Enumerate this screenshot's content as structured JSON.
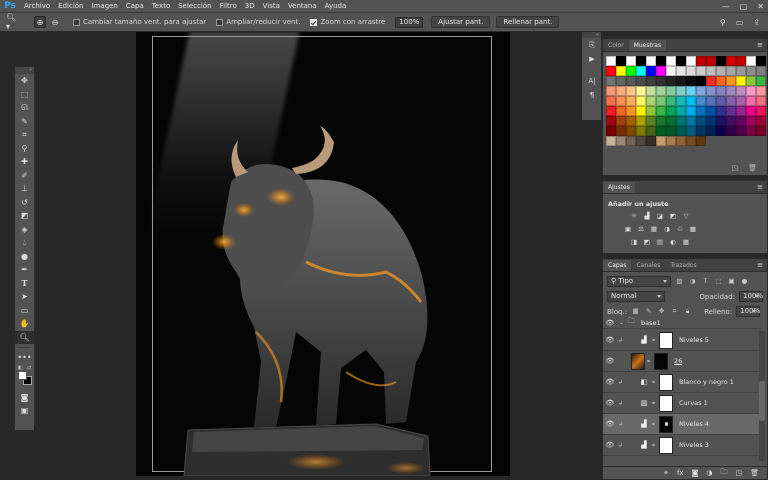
{
  "app": {
    "logo": "Ps"
  },
  "menubar": {
    "items": [
      "Archivo",
      "Edición",
      "Imagen",
      "Capa",
      "Texto",
      "Selección",
      "Filtro",
      "3D",
      "Vista",
      "Ventana",
      "Ayuda"
    ]
  },
  "options": {
    "resize_label": "Cambiar tamaño vent. para ajustar",
    "scrubby_label": "Ampliar/reducir vent.",
    "drag_label": "Zoom con arrastre",
    "zoom_value": "100%",
    "fit_label": "Ajustar pant.",
    "fill_label": "Rellenar pant."
  },
  "swatches": {
    "tabs": [
      "Color",
      "Muestras"
    ],
    "colors": [
      [
        "#ffffff",
        "#000000",
        "#ffffff",
        "#000000",
        "#ffffff",
        "#000000",
        "#ffffff",
        "#000000",
        "#ffffff",
        "#c00000",
        "#c00000",
        "#000000",
        "#d40000",
        "#c00000",
        "#ffffff",
        "#000000"
      ],
      [
        "#ff0000",
        "#ffff00",
        "#00ff00",
        "#00ffff",
        "#0000ff",
        "#ff00ff",
        "#ffffff",
        "#e6e6e6",
        "#d9d9d9",
        "#cccccc",
        "#bfbfbf",
        "#b3b3b3",
        "#a6a6a6",
        "#999999",
        "#8c8c8c",
        "#808080"
      ],
      [
        "#737373",
        "#666666",
        "#595959",
        "#4d4d4d",
        "#404040",
        "#333333",
        "#262626",
        "#1a1a1a",
        "#0d0d0d",
        "#000000",
        "#ee2e24",
        "#f26522",
        "#f7941d",
        "#fff200",
        "#8dc63f",
        "#39b54a"
      ],
      [
        "#f7977a",
        "#f9ad81",
        "#fdc68a",
        "#fff79a",
        "#c4df9b",
        "#a3d39c",
        "#82ca9d",
        "#7bcdc8",
        "#6ecff6",
        "#7ea7d8",
        "#8493ca",
        "#8882be",
        "#a187be",
        "#bc8dbf",
        "#f49ac2",
        "#f6989d"
      ],
      [
        "#f26c4f",
        "#f68e56",
        "#fbaf5d",
        "#fff568",
        "#acd373",
        "#7cc576",
        "#3bb878",
        "#1abbb4",
        "#00bff3",
        "#448ccb",
        "#5674b9",
        "#605ca8",
        "#855fa8",
        "#a863a8",
        "#f06eaa",
        "#f26d7d"
      ],
      [
        "#ed1c24",
        "#f26522",
        "#f7941d",
        "#fff200",
        "#8dc63f",
        "#39b54a",
        "#00a651",
        "#00a99d",
        "#00aeef",
        "#0072bc",
        "#0054a6",
        "#2e3192",
        "#662d91",
        "#92278f",
        "#ec008c",
        "#ed145b"
      ],
      [
        "#9e0b0f",
        "#a0410d",
        "#a36209",
        "#aba000",
        "#598527",
        "#1a7b30",
        "#007236",
        "#00746b",
        "#0076a3",
        "#004b80",
        "#003471",
        "#1b1464",
        "#440e62",
        "#630460",
        "#9e005d",
        "#9e0039"
      ],
      [
        "#790000",
        "#7b2e00",
        "#7d4900",
        "#827b00",
        "#406618",
        "#005e20",
        "#005826",
        "#005952",
        "#005b7f",
        "#003663",
        "#002157",
        "#0d004c",
        "#32004b",
        "#4b0049",
        "#7b0046",
        "#7a0026"
      ],
      [
        "#c7b299",
        "#998675",
        "#736357",
        "#534741",
        "#37302d",
        "#c69c6d",
        "#a67c52",
        "#8c6239",
        "#754c24",
        "#603913"
      ]
    ]
  },
  "adjust": {
    "tab": "Ajustes",
    "title": "Añadir un ajuste",
    "row1": [
      "☼",
      "▟",
      "◪",
      "◩",
      "▽"
    ],
    "row2": [
      "▣",
      "⚖",
      "▦",
      "◑",
      "♲",
      "▩"
    ],
    "row3": [
      "◨",
      "◩",
      "▤",
      "◐",
      "▦"
    ]
  },
  "layers": {
    "tabs": [
      "Capas",
      "Canales",
      "Trazados"
    ],
    "filter_type": "Tipo",
    "blend_mode": "Normal",
    "opacity_label": "Opacidad:",
    "opacity_value": "100%",
    "lock_label": "Bloq.:",
    "fill_label": "Relleno:",
    "fill_value": "100%",
    "group_name": "base1",
    "items": [
      {
        "name": "Niveles 5",
        "kind": "adj",
        "icon": "▟",
        "mask": "white",
        "selected": false
      },
      {
        "name": "26",
        "kind": "image",
        "icon": "",
        "mask": "photo",
        "selected": false
      },
      {
        "name": "Blanco y negro 1",
        "kind": "adj",
        "icon": "◧",
        "mask": "white",
        "selected": false
      },
      {
        "name": "Curvas 1",
        "kind": "adj",
        "icon": "▨",
        "mask": "white",
        "selected": false
      },
      {
        "name": "Niveles 4",
        "kind": "adj",
        "icon": "▟",
        "mask": "black",
        "selected": true
      },
      {
        "name": "Niveles 3",
        "kind": "adj",
        "icon": "▟",
        "mask": "white",
        "selected": false
      }
    ]
  },
  "icons": {
    "colors": [
      "#31a8ff",
      "#ff9b1f",
      "#e8e8e8"
    ]
  }
}
